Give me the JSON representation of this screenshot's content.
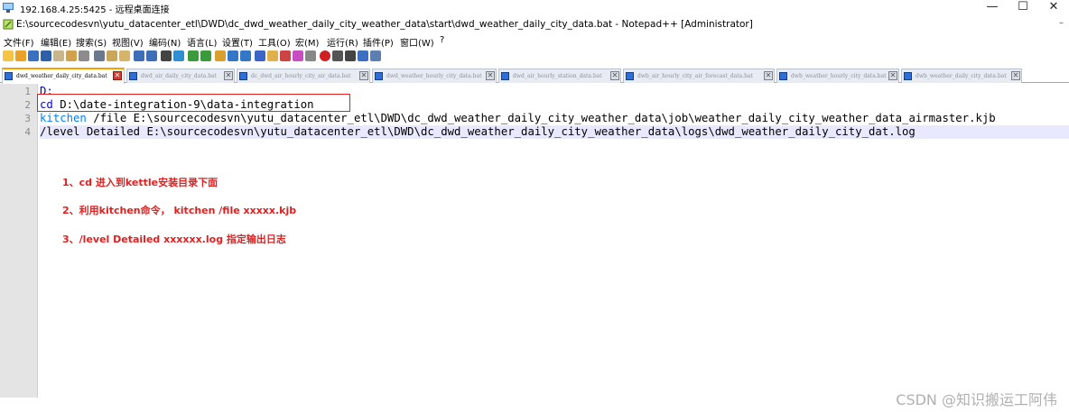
{
  "rdp_window": {
    "title": "192.168.4.25:5425 - 远程桌面连接",
    "minimize": "—",
    "maximize": "☐",
    "close": "✕"
  },
  "notepad": {
    "title": "E:\\sourcecodesvn\\yutu_datacenter_etl\\DWD\\dc_dwd_weather_daily_city_weather_data\\start\\dwd_weather_daily_city_data.bat - Notepad++ [Administrator]",
    "menu": [
      "文件(F)",
      "编辑(E)",
      "搜索(S)",
      "视图(V)",
      "编码(N)",
      "语言(L)",
      "设置(T)",
      "工具(O)",
      "宏(M)",
      "运行(R)",
      "插件(P)",
      "窗口(W)",
      "?"
    ],
    "tabs": [
      {
        "label": "dwd_weather_daily_city_data.bat",
        "active": true
      },
      {
        "label": "dwd_air_daily_city_data.bat",
        "active": false
      },
      {
        "label": "dc_dwd_air_hourly_city_air_data.bat",
        "active": false
      },
      {
        "label": "dwd_weather_hourly_city_data.bat",
        "active": false
      },
      {
        "label": "dwd_air_hourly_station_data.bat",
        "active": false
      },
      {
        "label": "dwb_air_hourly_city_air_forecast_data.bat",
        "active": false
      },
      {
        "label": "dwb_weather_hourly_city_data.bat",
        "active": false
      },
      {
        "label": "dwb_weather_daily_city_data.bat",
        "active": false
      }
    ],
    "lines": [
      {
        "num": "1",
        "text": "D:"
      },
      {
        "num": "2",
        "keyword": "cd",
        "rest": " D:\\date-integration-9\\data-integration"
      },
      {
        "num": "3",
        "keyword": "kitchen",
        "rest": " /file E:\\sourcecodesvn\\yutu_datacenter_etl\\DWD\\dc_dwd_weather_daily_city_weather_data\\job\\weather_daily_city_weather_data_airmaster.kjb"
      },
      {
        "num": "4",
        "text": "/level Detailed E:\\sourcecodesvn\\yutu_datacenter_etl\\DWD\\dc_dwd_weather_daily_city_weather_data\\logs\\dwd_weather_daily_city_dat.log"
      }
    ]
  },
  "annotations": [
    "1、cd  进入到kettle安装目录下面",
    "2、利用kitchen命令， kitchen /file xxxxx.kjb",
    "3、/level Detailed xxxxxx.log  指定输出日志"
  ],
  "watermark": "CSDN @知识搬运工阿伟",
  "colors": {
    "annotation_red": "#e02020",
    "keyword_blue": "#0000ff",
    "active_tab_accent": "#f7a000"
  }
}
